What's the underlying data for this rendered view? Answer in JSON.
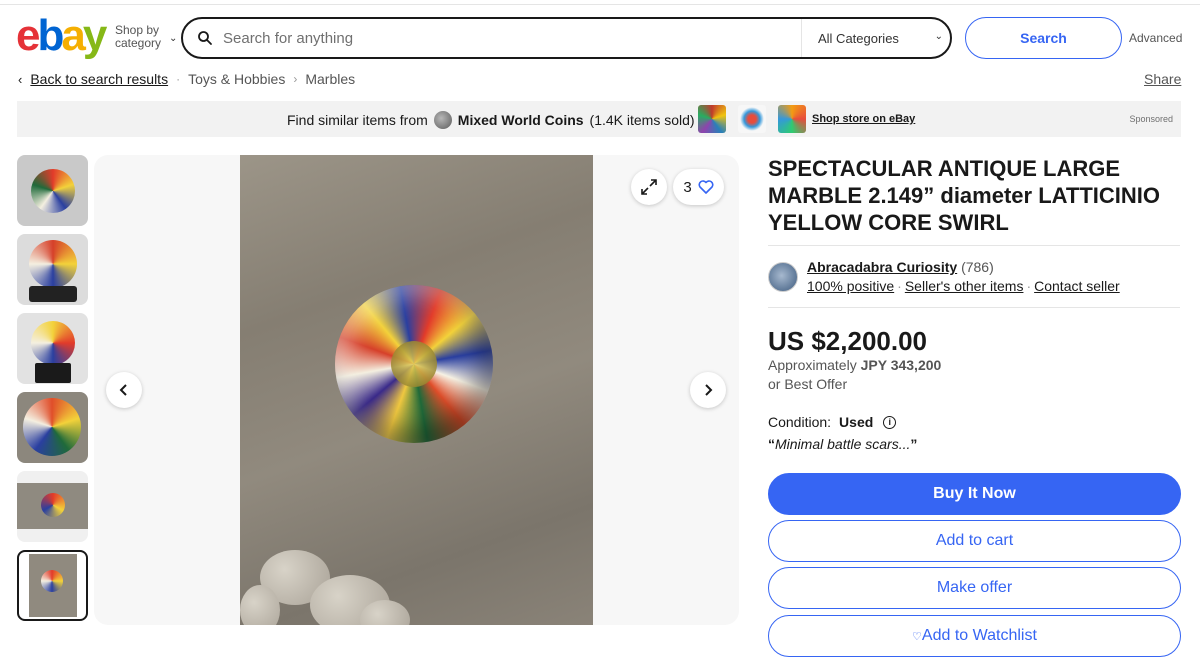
{
  "header": {
    "logo_text": "ebay",
    "shop_by_category": "Shop by category",
    "search_placeholder": "Search for anything",
    "category_selected": "All Categories",
    "search_button": "Search",
    "advanced_link": "Advanced"
  },
  "breadcrumb": {
    "back": "Back to search results",
    "items": [
      "Toys & Hobbies",
      "Marbles"
    ]
  },
  "share_label": "Share",
  "banner": {
    "prefix": "Find similar items from",
    "store_name": "Mixed World Coins",
    "items_sold": "(1.4K items sold)",
    "shop_store_link": "Shop store on eBay",
    "sponsored": "Sponsored"
  },
  "gallery": {
    "watch_count": "3",
    "thumbnail_count": 6,
    "selected_thumbnail": 6
  },
  "listing": {
    "title": "SPECTACULAR ANTIQUE LARGE MARBLE 2.149” diameter LATTICINIO YELLOW CORE SWIRL",
    "seller": {
      "name": "Abracadabra Curiosity",
      "feedback_count": "(786)",
      "positive": "100% positive",
      "other_items": "Seller's other items",
      "contact": "Contact seller"
    },
    "price": "US $2,200.00",
    "approx_label": "Approximately",
    "approx_value": "JPY 343,200",
    "best_offer": "or Best Offer",
    "condition_label": "Condition:",
    "condition_value": "Used",
    "condition_note": "Minimal battle scars..."
  },
  "actions": {
    "buy_now": "Buy It Now",
    "add_to_cart": "Add to cart",
    "make_offer": "Make offer",
    "add_to_watchlist": "Add to Watchlist"
  },
  "colors": {
    "ebay_red": "#e53238",
    "ebay_blue": "#0064d2",
    "ebay_yellow": "#f5af02",
    "ebay_green": "#86b817",
    "primary_button": "#3665f3"
  }
}
